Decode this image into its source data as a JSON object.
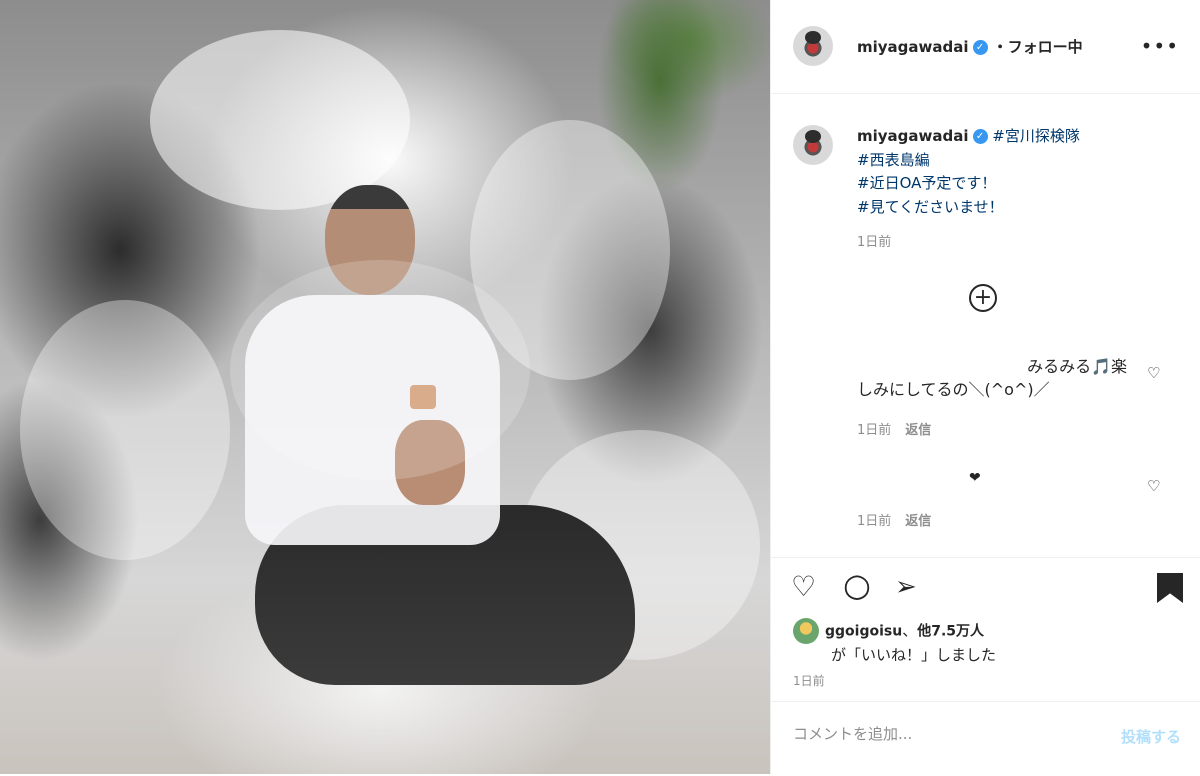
{
  "header": {
    "username": "miyagawadai",
    "verified_mark": "✓",
    "follow_status": "・フォロー中",
    "more_icon": "•••"
  },
  "caption": {
    "username": "miyagawadai",
    "hashtags": [
      "#宮川探検隊",
      "#西表島編",
      "#近日OA予定です！",
      "#見てくださいませ！"
    ],
    "time": "1日前"
  },
  "load_more_icon": "⊕",
  "comments": [
    {
      "line1": "みるみる🎵楽",
      "line2": "しみにしてるの＼(^o^)／",
      "time": "1日前",
      "reply": "返信",
      "heart_icon": "♡"
    },
    {
      "text": "❤",
      "time": "1日前",
      "reply": "返信",
      "heart_icon": "♡"
    }
  ],
  "actions": {
    "like_icon": "♡",
    "comment_icon": "○",
    "share_icon": "➢"
  },
  "likes": {
    "user": "ggoigoisu",
    "separator": "、",
    "others": "他7.5万人",
    "suffix": "が「いいね！」しました"
  },
  "post_time": "1日前",
  "comment_box": {
    "placeholder": "コメントを追加...",
    "post_label": "投稿する"
  }
}
